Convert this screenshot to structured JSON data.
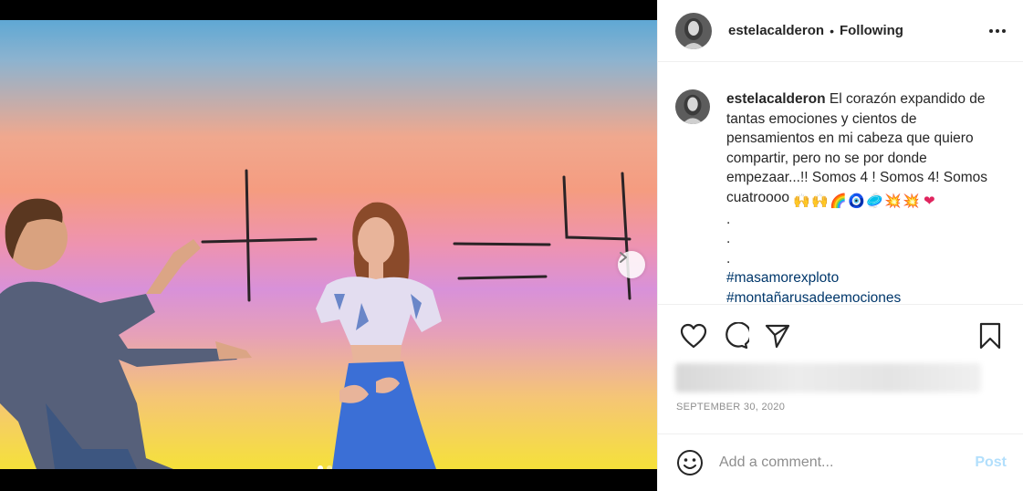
{
  "post": {
    "username": "estelacalderon",
    "follow_status": "Following",
    "bullet": "•",
    "caption_user": "estelacalderon",
    "caption_text": "El corazón expandido de tantas emociones y cientos de pensamientos en mi cabeza que quiero compartir, pero no se por donde empezaar...!! Somos 4 ! Somos 4! Somos cuatroooo",
    "caption_emojis": [
      "🙌",
      "🙌",
      "🌈",
      "🧿",
      "🥏",
      "💥",
      "💥",
      "❤"
    ],
    "dot_lines": [
      ".",
      ".",
      "."
    ],
    "hashtags": [
      "#masamorexploto",
      "#montañarusadeemociones"
    ],
    "timestamp": "SEPTEMBER 30, 2020"
  },
  "comment_box": {
    "placeholder": "Add a comment...",
    "post_label": "Post"
  },
  "carousel": {
    "slide_count": 2,
    "active_index": 0
  },
  "icons": {
    "more": "more-options-icon",
    "like": "heart-icon",
    "comment": "comment-icon",
    "share": "paper-plane-icon",
    "save": "bookmark-icon",
    "emoji": "smiley-icon",
    "next": "chevron-right-icon"
  },
  "colors": {
    "hashtag": "#00376b",
    "post_disabled": "#b2dffc",
    "muted": "#8e8e8e"
  }
}
